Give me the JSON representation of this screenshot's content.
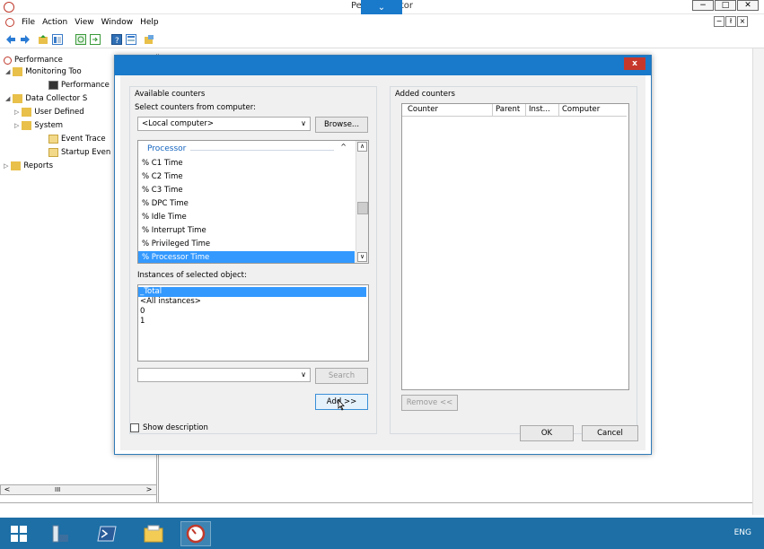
{
  "window": {
    "title": "Perfor…onitor",
    "title_center": "⌄",
    "controls": {
      "min": "−",
      "max": "□",
      "close": "✕"
    }
  },
  "menu": {
    "items": [
      "File",
      "Action",
      "View",
      "Window",
      "Help"
    ],
    "inner": {
      "min": "−",
      "restore": "ł",
      "close": "×"
    }
  },
  "tree": {
    "items": [
      {
        "label": "Performance",
        "icon": "performance-monitor-icon"
      },
      {
        "label": "Monitoring Too",
        "icon": "folder-icon",
        "expanded": "◢"
      },
      {
        "label": "Performance",
        "icon": "chart-icon"
      },
      {
        "label": "Data Collector S",
        "icon": "folder-icon",
        "expanded": "◢"
      },
      {
        "label": "User Defined",
        "icon": "folder-icon",
        "collapsed": "▷"
      },
      {
        "label": "System",
        "icon": "folder-icon",
        "collapsed": "▷"
      },
      {
        "label": "Event Trace",
        "icon": "file-icon"
      },
      {
        "label": "Startup Even",
        "icon": "file-icon"
      },
      {
        "label": "Reports",
        "icon": "folder-icon",
        "collapsed": "▷"
      }
    ],
    "scroll": {
      "left": "<",
      "thumb": "III",
      "right": ">"
    }
  },
  "dialog": {
    "close_label": "x",
    "available_counters_label": "Available counters",
    "select_computer_label": "Select counters from computer:",
    "computer_value": "<Local computer>",
    "browse_label": "Browse...",
    "group_name": "Processor",
    "collapse_glyph": "^",
    "counters": [
      "% C1 Time",
      "% C2 Time",
      "% C3 Time",
      "% DPC Time",
      "% Idle Time",
      "% Interrupt Time",
      "% Privileged Time",
      "% Processor Time"
    ],
    "selected_counter": "% Processor Time",
    "instances_label": "Instances of selected object:",
    "instances": [
      "_Total",
      "<All instances>",
      "0",
      "1"
    ],
    "selected_instance": "_Total",
    "search_value": "",
    "search_label": "Search",
    "add_label": "Add >>",
    "added_counters_label": "Added counters",
    "columns": [
      "Counter",
      "Parent",
      "Inst...",
      "Computer"
    ],
    "remove_label": "Remove <<",
    "show_description_label": "Show description",
    "ok_label": "OK",
    "cancel_label": "Cancel"
  },
  "taskbar": {
    "language": "ENG",
    "items": [
      "start-icon",
      "server-manager-icon",
      "powershell-icon",
      "file-explorer-icon",
      "performance-monitor-icon"
    ]
  }
}
